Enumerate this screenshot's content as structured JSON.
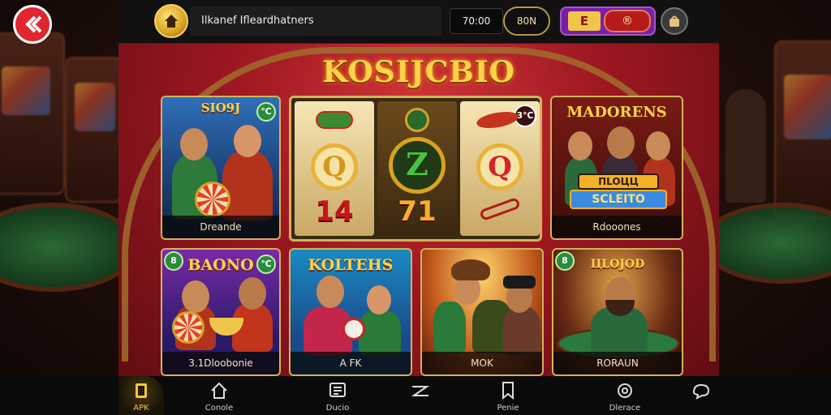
{
  "header": {
    "marquee_text": "Ilkanef Ifleardhatners",
    "balance": "70:00",
    "join_label": "80N",
    "toggle_left": "E",
    "toggle_right": "®"
  },
  "lobby": {
    "title": "KOSIJCBIO",
    "tiles": [
      {
        "name": "SIO9J",
        "label": "Dreande",
        "badge": "℃"
      },
      {
        "name": "MADORENS",
        "subtitle": "SCLEITO",
        "subtitle_top": "ПLOЦЦ",
        "label": "Rdooones"
      },
      {
        "name": "BAONO",
        "label": "3.1Dloobonie",
        "badge_left": "8",
        "badge_right": "℃"
      },
      {
        "name": "KOLTEHS",
        "label": "A FK"
      },
      {
        "name": "",
        "label": "MOK"
      },
      {
        "name": "ЦLOJOD",
        "label": "RORAUN",
        "badge": "8"
      }
    ],
    "slot": {
      "reels": [
        {
          "symbol": "Q",
          "number": "14"
        },
        {
          "symbol": "Z",
          "number": "71"
        },
        {
          "symbol": "Q",
          "number": ""
        }
      ],
      "badge": "3℃"
    }
  },
  "nav": {
    "items": [
      {
        "label": "APK",
        "icon": "apk-icon"
      },
      {
        "label": "Conole",
        "icon": "home-icon"
      },
      {
        "label": "Ducio",
        "icon": "document-icon"
      },
      {
        "label": "",
        "icon": "zigzag-icon"
      },
      {
        "label": "Penie",
        "icon": "bookmark-icon"
      },
      {
        "label": "Dlerace",
        "icon": "settings-icon"
      },
      {
        "label": "",
        "icon": "chat-icon"
      }
    ]
  },
  "colors": {
    "accent_gold": "#ffd24a",
    "felt_green": "#2a8a3e",
    "banner_red": "#b51b1b",
    "toggle_purple": "#7a1fa3"
  }
}
